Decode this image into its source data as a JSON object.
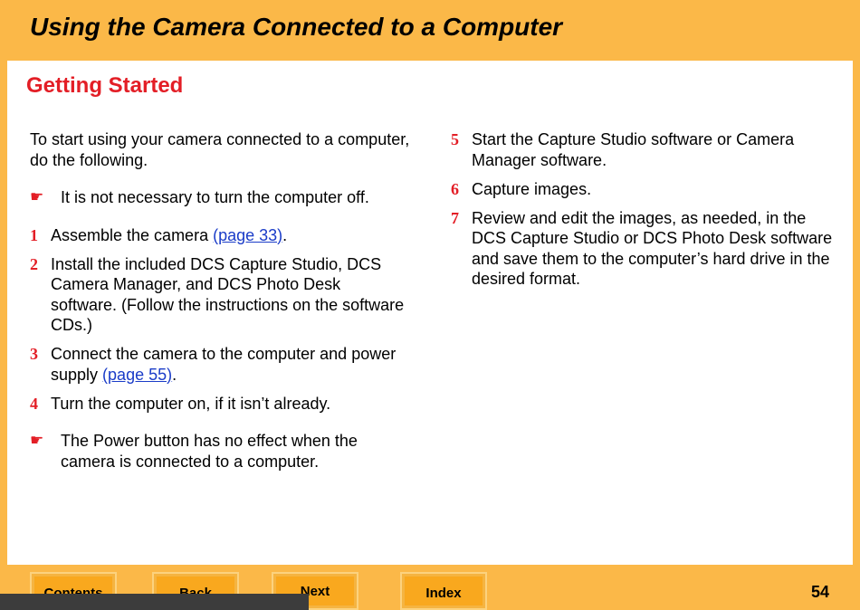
{
  "header": {
    "title": "Using the Camera Connected to a Computer"
  },
  "section": {
    "title": "Getting Started"
  },
  "intro": "To start using your camera connected to a computer, do the following.",
  "note_icon": "pointing-hand-icon",
  "notes": [
    "It is not necessary to turn the computer off.",
    "The Power button has no effect when the camera is connected to a computer."
  ],
  "steps": [
    {
      "num": "1",
      "text": "Assemble the camera ",
      "link": "(page 33)",
      "after": "."
    },
    {
      "num": "2",
      "text": "Install the included DCS Capture Studio, DCS Camera Manager, and DCS Photo Desk software. (Follow the instructions on the software CDs.)"
    },
    {
      "num": "3",
      "text": "Connect the camera to the computer and power supply ",
      "link": "(page 55)",
      "after": "."
    },
    {
      "num": "4",
      "text": "Turn the computer on, if it isn’t already."
    },
    {
      "num": "5",
      "text": "Start the Capture Studio software or Camera Manager software."
    },
    {
      "num": "6",
      "text": "Capture images."
    },
    {
      "num": "7",
      "text": "Review and edit the images, as needed, in the DCS Capture Studio or DCS Photo Desk software and save them to the computer’s hard drive in the desired format."
    }
  ],
  "nav": {
    "contents": "Contents",
    "back": "Back",
    "next": "Next",
    "index": "Index"
  },
  "page_number": "54",
  "colors": {
    "background": "#fbb848",
    "accent_red": "#e31e26",
    "link_blue": "#1a3cc8",
    "button": "#f9a81e"
  }
}
